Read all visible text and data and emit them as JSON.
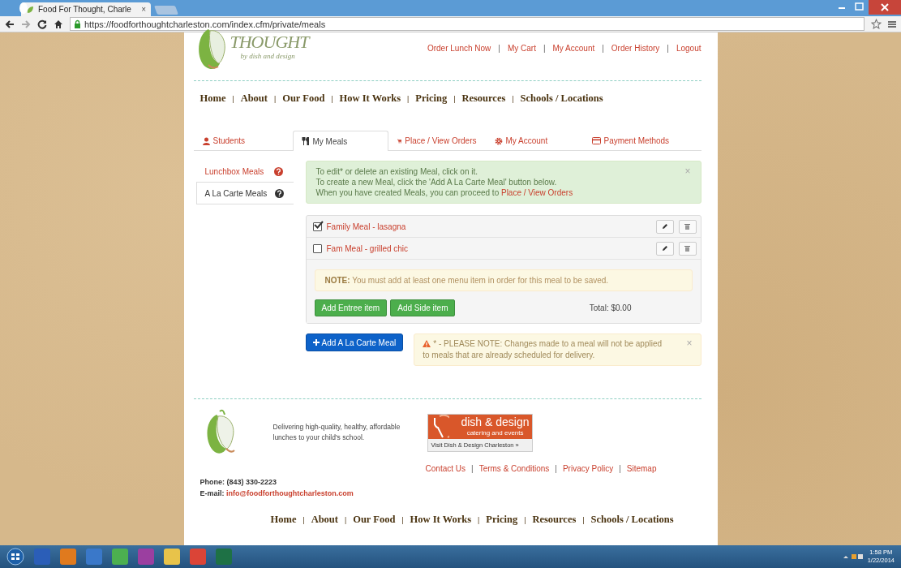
{
  "browser": {
    "tab_title": "Food For Thought, Charle",
    "tab_close": "×",
    "url": "https://foodforthoughtcharleston.com/index.cfm/private/meals"
  },
  "header": {
    "logo_word": "THOUGHT",
    "logo_tagline": "by dish and design",
    "separator": "|",
    "top_links": [
      "Order Lunch Now",
      "My Cart",
      "My Account",
      "Order History",
      "Logout"
    ],
    "nav": [
      "Home",
      "About",
      "Our Food",
      "How It Works",
      "Pricing",
      "Resources",
      "Schools / Locations"
    ]
  },
  "tabs": [
    {
      "label": "Students",
      "selected": false
    },
    {
      "label": "My Meals",
      "selected": true
    },
    {
      "label": "Place / View Orders",
      "selected": false
    },
    {
      "label": "My Account",
      "selected": false
    },
    {
      "label": "Payment Methods",
      "selected": false
    }
  ],
  "side_nav": [
    {
      "label": "Lunchbox Meals",
      "selected": false
    },
    {
      "label": "A La Carte Meals",
      "selected": true
    }
  ],
  "info_alert": {
    "lines": [
      "To edit* or delete an existing Meal, click on it.",
      "To create a new Meal, click the 'Add A La Carte Meal' button below.",
      "When you have created Meals, you can proceed to"
    ],
    "link": "Place / View Orders",
    "close": "×"
  },
  "meals": [
    {
      "name": "Family Meal - lasagna",
      "checked": true
    },
    {
      "name": "Fam Meal - grilled chic",
      "checked": false,
      "body": {
        "note": "**NOTE:** You must add at least one menu item in order for this meal to be saved.",
        "buttons": [
          "Add Entree item",
          "Add Side item"
        ],
        "total": "Total: $0.00"
      }
    }
  ],
  "add_button": "Add A La Carte Meal",
  "warning": {
    "text": "* - PLEASE NOTE: Changes made to a meal will not be applied to meals that are already scheduled for delivery.",
    "close": "×"
  },
  "footer": {
    "tagline": "Delivering high-quality, healthy, affordable lunches to your child's school.",
    "banner_title": "dish & design",
    "banner_subtitle": "catering and events",
    "banner_link": "Visit Dish & Design Charleston »",
    "separator": "|",
    "links": [
      "Contact Us",
      "Terms & Conditions",
      "Privacy Policy",
      "Sitemap"
    ],
    "phone": "Phone: (843) 330-2223",
    "email_label": "E-mail:",
    "email": "info@foodforthoughtcharleston.com",
    "nav": [
      "Home",
      "About",
      "Our Food",
      "How It Works",
      "Pricing",
      "Resources",
      "Schools / Locations"
    ]
  },
  "taskbar": {
    "time": "1:58 PM",
    "date": "1/22/2014"
  }
}
